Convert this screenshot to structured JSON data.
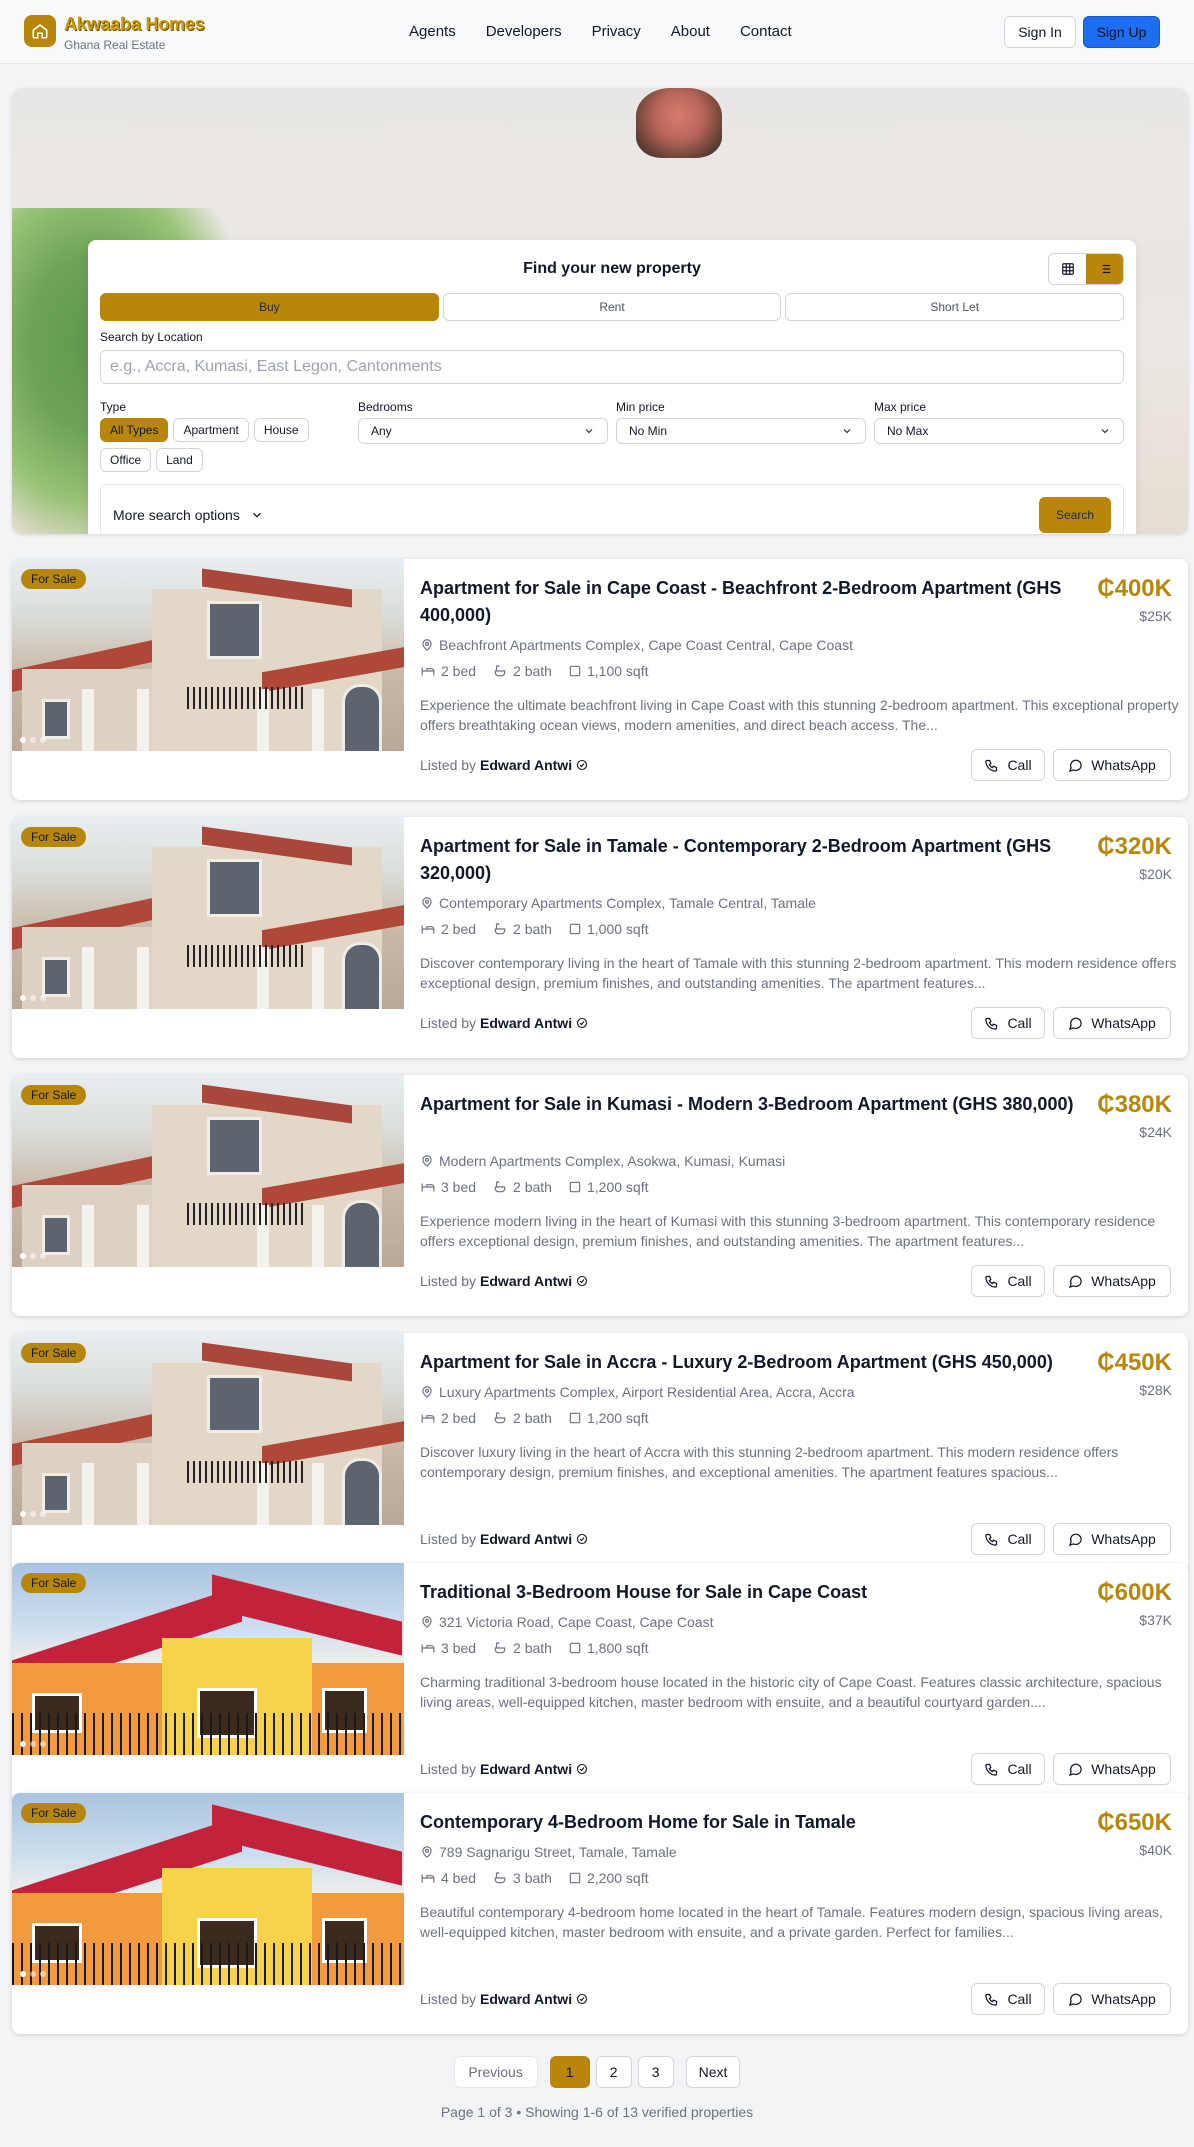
{
  "brand": {
    "title": "Akwaaba Homes",
    "subtitle": "Ghana Real Estate"
  },
  "nav": [
    "Agents",
    "Developers",
    "Privacy",
    "About",
    "Contact"
  ],
  "auth": {
    "signin": "Sign In",
    "signup": "Sign Up"
  },
  "colors": {
    "accent": "#b8860b",
    "primary": "#1d6ef0"
  },
  "search": {
    "title": "Find your new property",
    "modes": [
      "Buy",
      "Rent",
      "Short Let"
    ],
    "active_mode": "Buy",
    "location_label": "Search by Location",
    "location_placeholder": "e.g., Accra, Kumasi, East Legon, Cantonments",
    "type_label": "Type",
    "types": [
      "All Types",
      "Apartment",
      "House",
      "Office",
      "Land"
    ],
    "active_type": "All Types",
    "bedrooms_label": "Bedrooms",
    "bedrooms_value": "Any",
    "min_price_label": "Min price",
    "min_price_value": "No Min",
    "max_price_label": "Max price",
    "max_price_value": "No Max",
    "more_options": "More search options",
    "search_button": "Search"
  },
  "listing_labels": {
    "listed_by": "Listed by",
    "call": "Call",
    "whatsapp": "WhatsApp"
  },
  "listings": [
    {
      "badge": "For Sale",
      "title": "Apartment for Sale in Cape Coast - Beachfront 2-Bedroom Apartment (GHS 400,000)",
      "price": "₵400K",
      "usd": "$25K",
      "address": "Beachfront Apartments Complex, Cape Coast Central, Cape Coast",
      "beds": "2 bed",
      "baths": "2 bath",
      "area": "1,100 sqft",
      "description": "Experience the ultimate beachfront living in Cape Coast with this stunning 2-bedroom apartment. This exceptional property offers breathtaking ocean views, modern amenities, and direct beach access. The...",
      "agent": "Edward Antwi",
      "photo": "apartment"
    },
    {
      "badge": "For Sale",
      "title": "Apartment for Sale in Tamale - Contemporary 2-Bedroom Apartment (GHS 320,000)",
      "price": "₵320K",
      "usd": "$20K",
      "address": "Contemporary Apartments Complex, Tamale Central, Tamale",
      "beds": "2 bed",
      "baths": "2 bath",
      "area": "1,000 sqft",
      "description": "Discover contemporary living in the heart of Tamale with this stunning 2-bedroom apartment. This modern residence offers exceptional design, premium finishes, and outstanding amenities. The apartment features...",
      "agent": "Edward Antwi",
      "photo": "apartment"
    },
    {
      "badge": "For Sale",
      "title": "Apartment for Sale in Kumasi - Modern 3-Bedroom Apartment (GHS 380,000)",
      "price": "₵380K",
      "usd": "$24K",
      "address": "Modern Apartments Complex, Asokwa, Kumasi, Kumasi",
      "beds": "3 bed",
      "baths": "2 bath",
      "area": "1,200 sqft",
      "description": "Experience modern living in the heart of Kumasi with this stunning 3-bedroom apartment. This contemporary residence offers exceptional design, premium finishes, and outstanding amenities. The apartment features...",
      "agent": "Edward Antwi",
      "photo": "apartment"
    },
    {
      "badge": "For Sale",
      "title": "Apartment for Sale in Accra - Luxury 2-Bedroom Apartment (GHS 450,000)",
      "price": "₵450K",
      "usd": "$28K",
      "address": "Luxury Apartments Complex, Airport Residential Area, Accra, Accra",
      "beds": "2 bed",
      "baths": "2 bath",
      "area": "1,200 sqft",
      "description": "Discover luxury living in the heart of Accra with this stunning 2-bedroom apartment. This modern residence offers contemporary design, premium finishes, and exceptional amenities. The apartment features spacious...",
      "agent": "Edward Antwi",
      "photo": "apartment"
    },
    {
      "badge": "For Sale",
      "title": "Traditional 3-Bedroom House for Sale in Cape Coast",
      "price": "₵600K",
      "usd": "$37K",
      "address": "321 Victoria Road, Cape Coast, Cape Coast",
      "beds": "3 bed",
      "baths": "2 bath",
      "area": "1,800 sqft",
      "description": "Charming traditional 3-bedroom house located in the historic city of Cape Coast. Features classic architecture, spacious living areas, well-equipped kitchen, master bedroom with ensuite, and a beautiful courtyard garden....",
      "agent": "Edward Antwi",
      "photo": "house"
    },
    {
      "badge": "For Sale",
      "title": "Contemporary 4-Bedroom Home for Sale in Tamale",
      "price": "₵650K",
      "usd": "$40K",
      "address": "789 Sagnarigu Street, Tamale, Tamale",
      "beds": "4 bed",
      "baths": "3 bath",
      "area": "2,200 sqft",
      "description": "Beautiful contemporary 4-bedroom home located in the heart of Tamale. Features modern design, spacious living areas, well-equipped kitchen, master bedroom with ensuite, and a private garden. Perfect for families...",
      "agent": "Edward Antwi",
      "photo": "house"
    }
  ],
  "pagination": {
    "previous": "Previous",
    "pages": [
      "1",
      "2",
      "3"
    ],
    "current": "1",
    "next": "Next",
    "info": "Page 1 of 3 • Showing 1-6 of 13 verified properties"
  }
}
